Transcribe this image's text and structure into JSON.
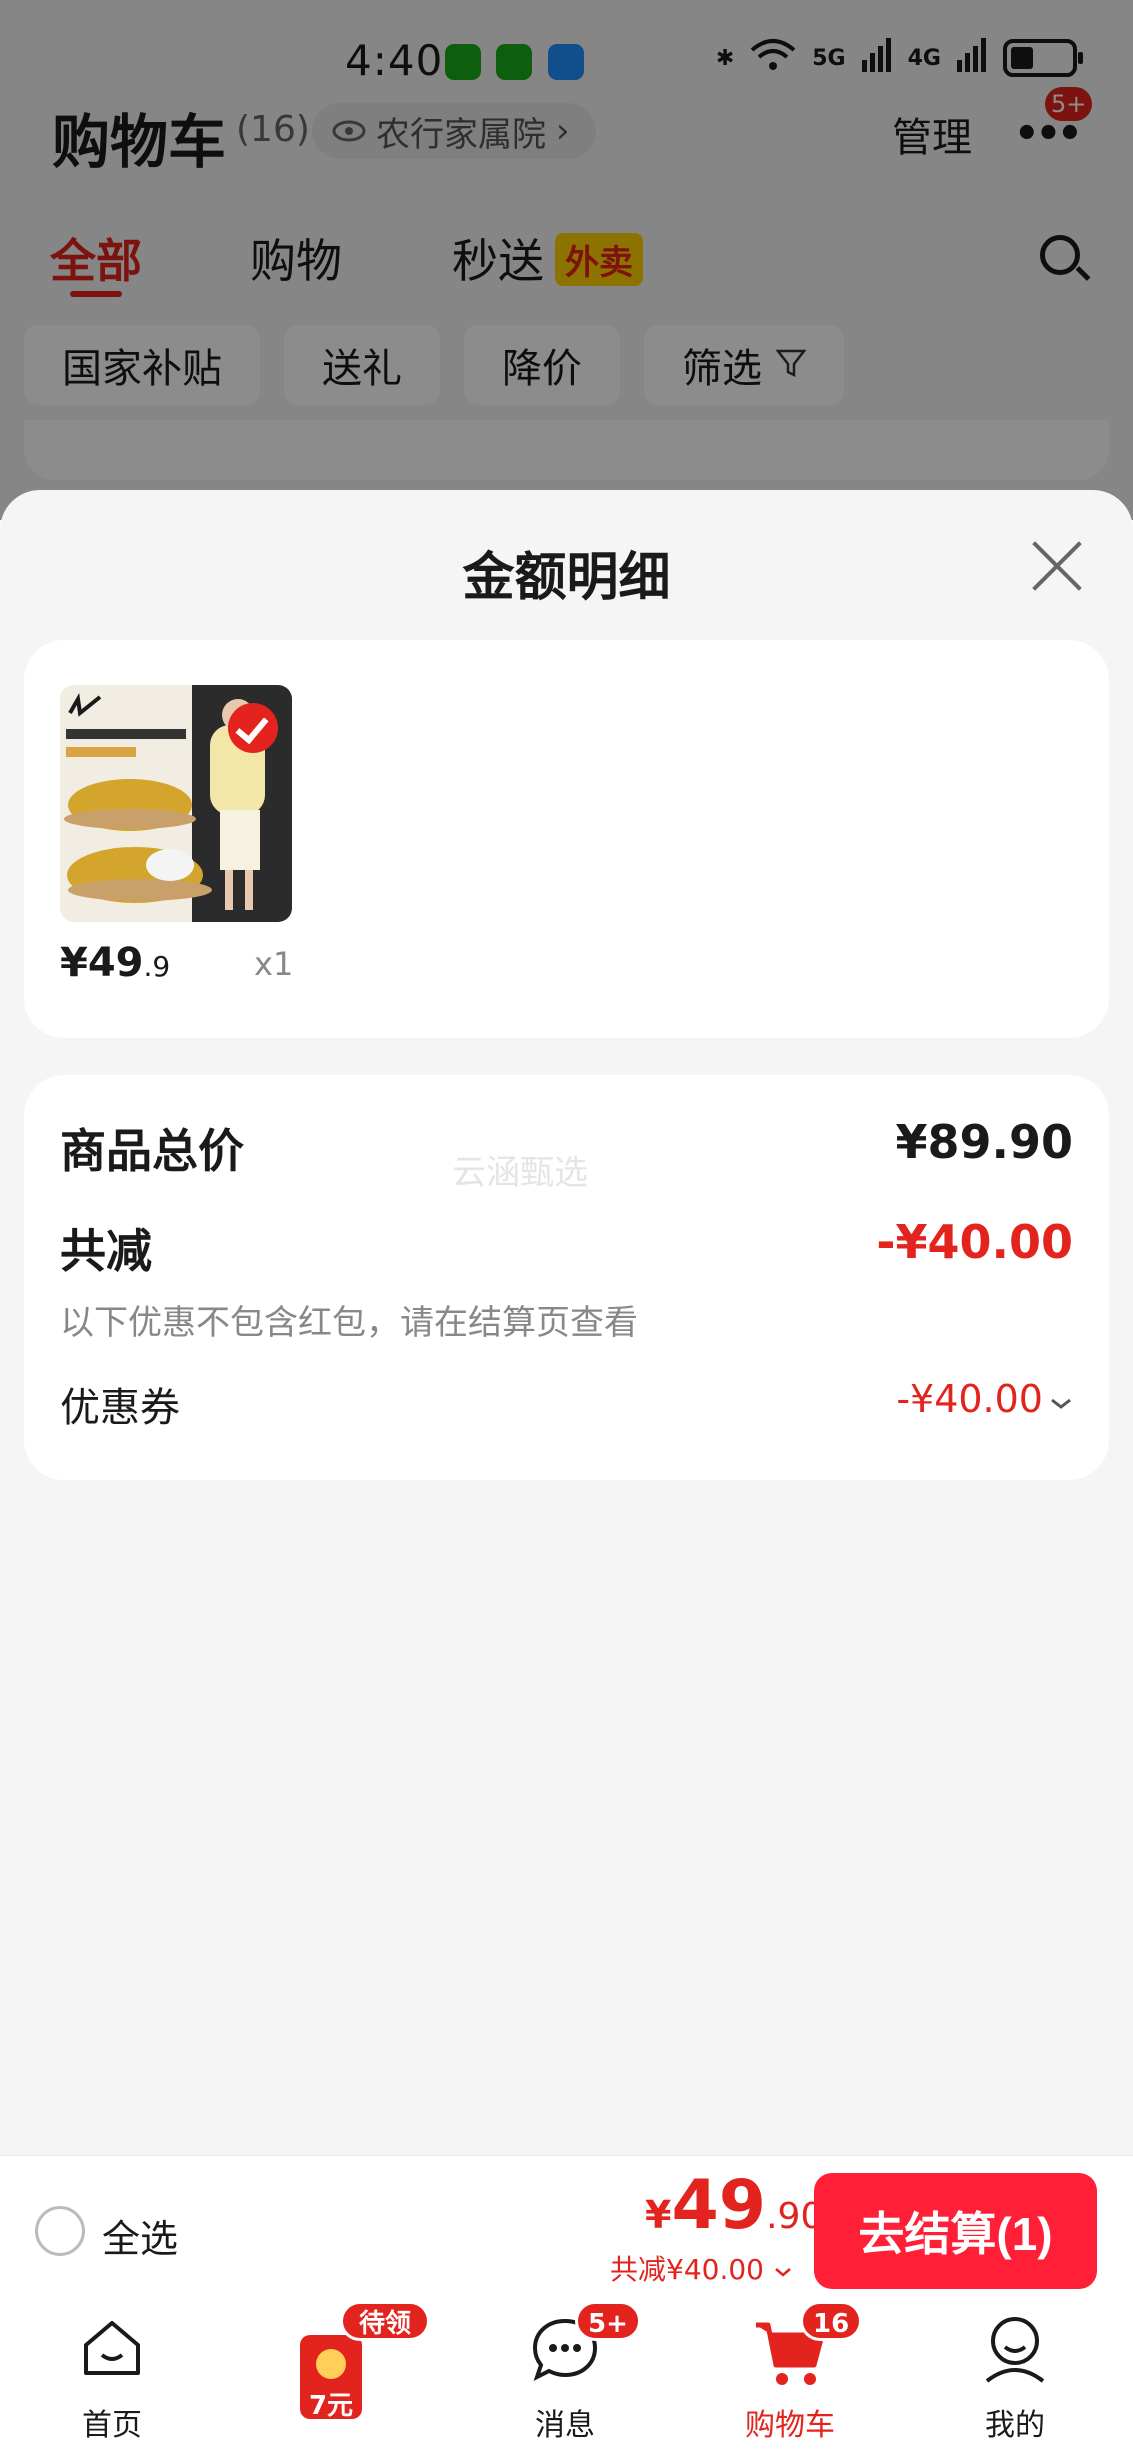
{
  "status_bar": {
    "time": "4:40",
    "signal_1": "5G",
    "signal_2": "4G"
  },
  "header": {
    "title": "购物车",
    "count": "(16)",
    "location": "农行家属院",
    "manage": "管理",
    "more_badge": "5+"
  },
  "tabs": [
    {
      "label": "全部",
      "active": true
    },
    {
      "label": "购物",
      "active": false
    },
    {
      "label": "秒送",
      "active": false
    }
  ],
  "tab_tag": "外卖",
  "filter_chips": [
    "国家补贴",
    "送礼",
    "降价",
    "筛选"
  ],
  "sheet": {
    "title": "金额明细",
    "product": {
      "price_int": "¥49",
      "price_dec": ".9",
      "qty": "x1"
    },
    "summary": {
      "total_label": "商品总价",
      "total_value": "¥89.90",
      "discount_label": "共减",
      "discount_value": "-¥40.00",
      "discount_note": "以下优惠不包含红包，请在结算页查看",
      "coupon_label": "优惠券",
      "coupon_value": "-¥40.00",
      "watermark": "云涵甄选"
    }
  },
  "checkout": {
    "select_all": "全选",
    "price_yen": "¥",
    "price_int": "49",
    "price_dec": ".90",
    "discount": "共减¥40.00",
    "button": "去结算(1)"
  },
  "bottom_nav": [
    {
      "label": "首页",
      "badge": ""
    },
    {
      "label": "",
      "badge": "待领取",
      "promo_text": "7元"
    },
    {
      "label": "消息",
      "badge": "5+"
    },
    {
      "label": "购物车",
      "badge": "16"
    },
    {
      "label": "我的",
      "badge": ""
    }
  ],
  "colors": {
    "accent": "#e3231d",
    "checkout_button": "#ff1f36",
    "tag_yellow": "#ffd200"
  }
}
